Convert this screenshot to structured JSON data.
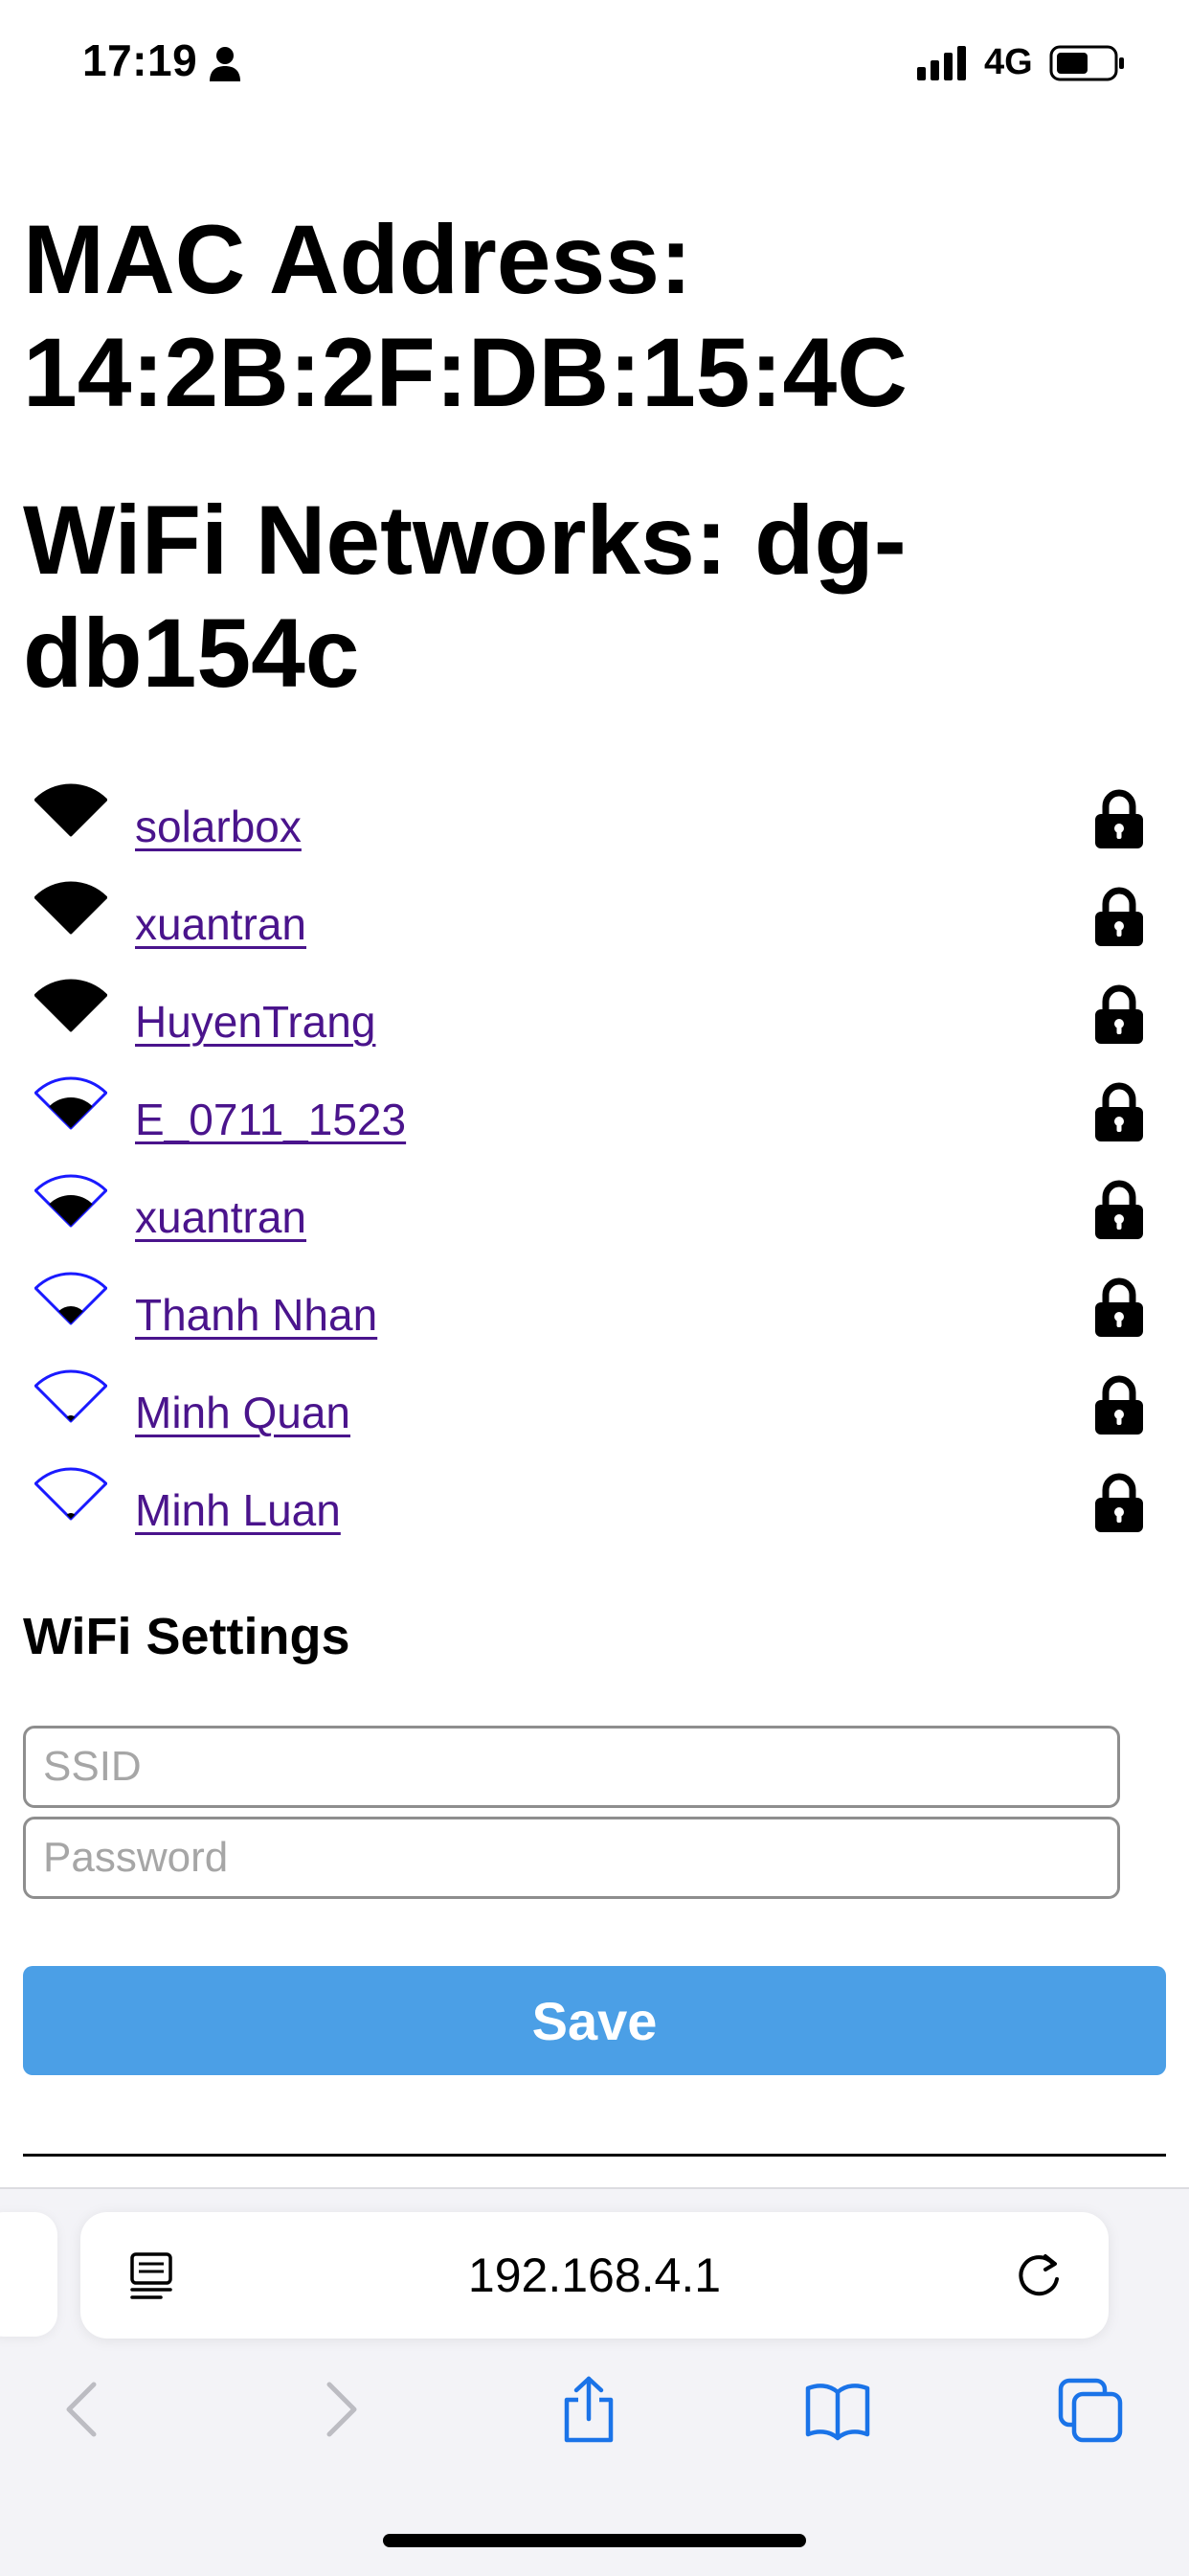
{
  "status": {
    "time": "17:19",
    "network": "4G"
  },
  "page": {
    "mac_title": "MAC Address:",
    "mac_value": "14:2B:2F:DB:15:4C",
    "wifi_title": "WiFi Networks: dg-",
    "wifi_subtitle": "db154c",
    "networks": [
      {
        "ssid": "solarbox",
        "signal": 4,
        "locked": true
      },
      {
        "ssid": "xuantran",
        "signal": 4,
        "locked": true
      },
      {
        "ssid": "HuyenTrang",
        "signal": 4,
        "locked": true
      },
      {
        "ssid": "E_0711_1523",
        "signal": 3,
        "locked": true
      },
      {
        "ssid": "xuantran",
        "signal": 3,
        "locked": true
      },
      {
        "ssid": "Thanh Nhan",
        "signal": 2,
        "locked": true
      },
      {
        "ssid": "Minh Quan",
        "signal": 1,
        "locked": true
      },
      {
        "ssid": "Minh Luan",
        "signal": 1,
        "locked": true
      }
    ],
    "settings_title": "WiFi Settings",
    "ssid_placeholder": "SSID",
    "password_placeholder": "Password",
    "save_label": "Save"
  },
  "browser": {
    "url": "192.168.4.1"
  },
  "colors": {
    "link": "#4a148c",
    "button": "#4b9fe6",
    "wifi_outline": "#1a1aff"
  }
}
